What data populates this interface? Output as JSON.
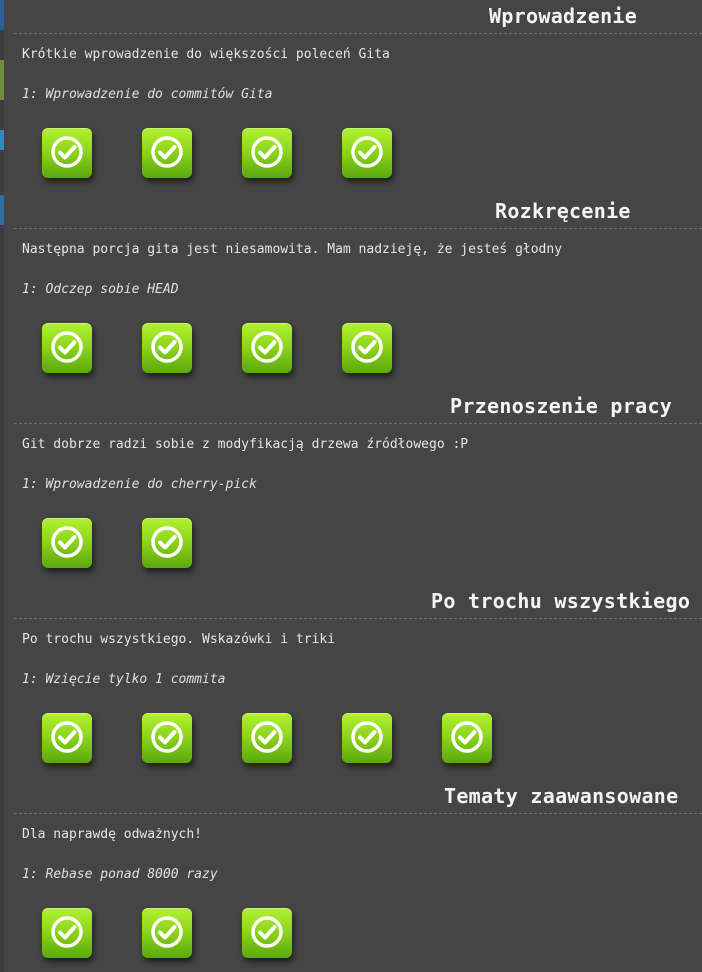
{
  "sections": [
    {
      "title": "Wprowadzenie",
      "description": "Krótkie wprowadzenie do większości poleceń Gita",
      "sequence_label": "1: Wprowadzenie do commitów Gita",
      "level_count": 4,
      "status": "completed"
    },
    {
      "title": "Rozkręcenie",
      "description": "Następna porcja gita jest niesamowita. Mam nadzieję, że jesteś głodny",
      "sequence_label": "1: Odczep sobie HEAD",
      "level_count": 4,
      "status": "completed"
    },
    {
      "title": "Przenoszenie pracy",
      "description": "Git dobrze radzi sobie z modyfikacją drzewa źródłowego :P",
      "sequence_label": "1: Wprowadzenie do cherry-pick",
      "level_count": 2,
      "status": "completed"
    },
    {
      "title": "Po trochu wszystkiego",
      "description": "Po trochu wszystkiego. Wskazówki i triki",
      "sequence_label": "1: Wzięcie tylko 1 commita",
      "level_count": 5,
      "status": "completed"
    },
    {
      "title": "Tematy zaawansowane",
      "description": "Dla naprawdę odważnych!",
      "sequence_label": "1: Rebase ponad 8000 razy",
      "level_count": 3,
      "status": "completed"
    }
  ],
  "icon": "check-circle-icon",
  "colors": {
    "background": "#454545",
    "level_button": "#8fd61e",
    "check": "#ffffff"
  }
}
